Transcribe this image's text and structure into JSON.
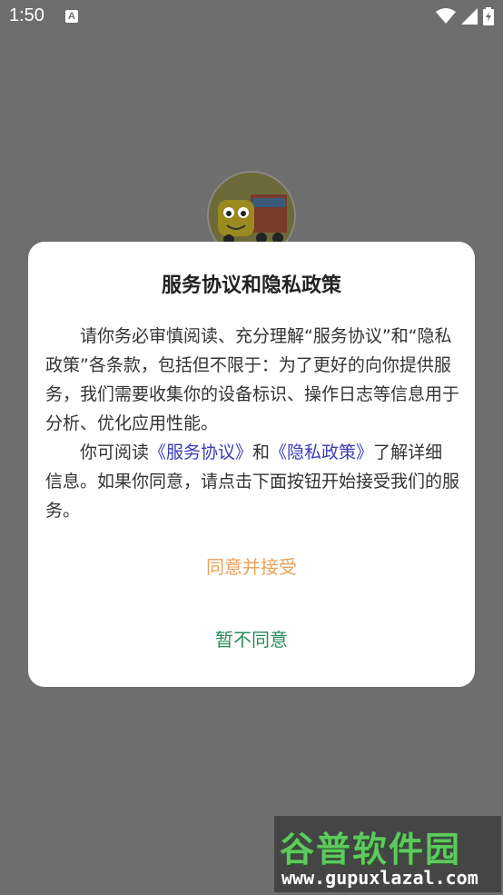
{
  "status_bar": {
    "time": "1:50",
    "notification_letter": "A"
  },
  "dialog": {
    "title": "服务协议和隐私政策",
    "para1": "请你务必审慎阅读、充分理解“服务协议”和“隐私政策”各条款，包括但不限于：为了更好的向你提供服务，我们需要收集你的设备标识、操作日志等信息用于分析、优化应用性能。",
    "para2_prefix": "你可阅读",
    "link_service": "《服务协议》",
    "para2_and": "和",
    "link_privacy": "《隐私政策》",
    "para2_suffix": "了解详细信息。如果你同意，请点击下面按钮开始接受我们的服务。",
    "accept_label": "同意并接受",
    "decline_label": "暂不同意"
  },
  "watermark": {
    "title": "谷普软件园",
    "url": "www.gupuxlazal.com"
  },
  "colors": {
    "overlay": "#6e6e6e",
    "accept": "#e8a25a",
    "decline": "#2b8a5a",
    "link": "#3b3bb8"
  }
}
